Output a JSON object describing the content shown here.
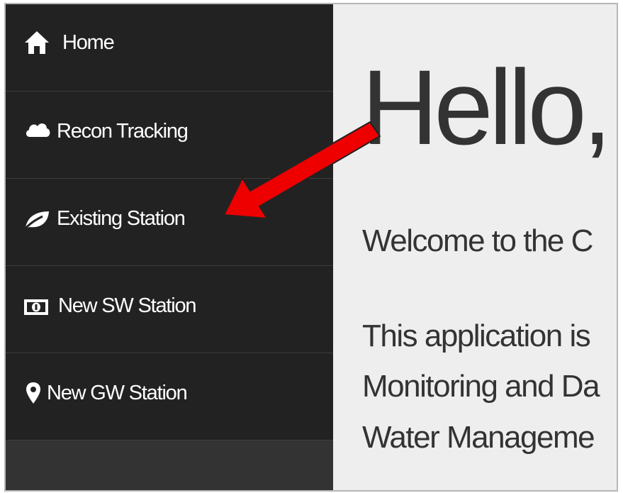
{
  "sidebar": {
    "items": [
      {
        "label": "Home",
        "icon": "home-icon"
      },
      {
        "label": "Recon Tracking",
        "icon": "cloud-icon"
      },
      {
        "label": "Existing Station",
        "icon": "leaf-icon"
      },
      {
        "label": "New SW Station",
        "icon": "money-icon"
      },
      {
        "label": "New GW Station",
        "icon": "map-marker-icon"
      }
    ]
  },
  "main": {
    "heading": "Hello,",
    "welcome": "Welcome to the C",
    "body_lines": [
      "This application is",
      "Monitoring and Da",
      "Water Manageme"
    ]
  },
  "annotation": {
    "arrow_color": "#ee0000",
    "points_to": "Existing Station"
  }
}
